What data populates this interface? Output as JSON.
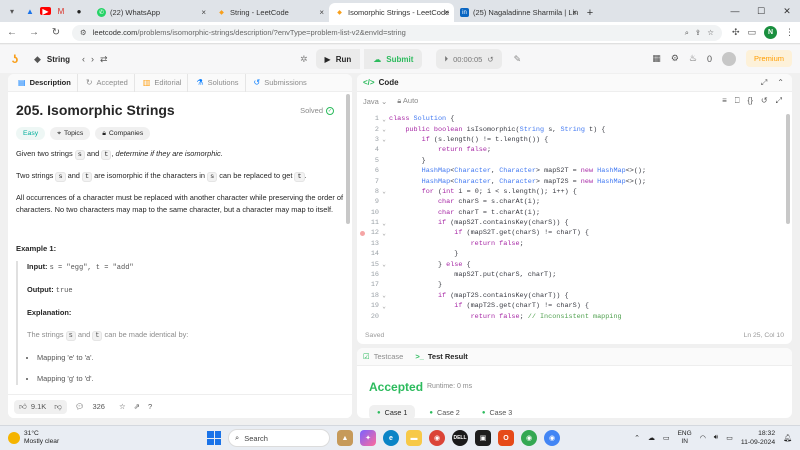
{
  "browser": {
    "tabs": [
      {
        "label": "(22) WhatsApp",
        "active": false
      },
      {
        "label": "String - LeetCode",
        "active": false
      },
      {
        "label": "Isomorphic Strings - LeetCode",
        "active": true
      },
      {
        "label": "(25) Nagaladinne Sharmila | Lin",
        "active": false
      }
    ],
    "new_tab": "+",
    "url_host": "leetcode.com",
    "url_path": "/problems/isomorphic-strings/description/?envType=problem-list-v2&envId=string",
    "profile_initial": "N"
  },
  "header": {
    "problem_list": "String",
    "run_label": "Run",
    "submit_label": "Submit",
    "timer": "00:00:05",
    "notifications": "0",
    "premium": "Premium"
  },
  "left": {
    "tabs": [
      "Description",
      "Accepted",
      "Editorial",
      "Solutions",
      "Submissions"
    ],
    "title": "205. Isomorphic Strings",
    "solved": "Solved",
    "chips": [
      "Easy",
      "Topics",
      "Companies"
    ],
    "para1_a": "Given two strings ",
    "para1_s": "s",
    "para1_b": " and ",
    "para1_t": "t",
    "para1_c": ", ",
    "para1_d": "determine if they are isomorphic",
    "para1_e": ".",
    "para2_a": "Two strings ",
    "para2_s": "s",
    "para2_b": " and ",
    "para2_t": "t",
    "para2_c": " are isomorphic if the characters in ",
    "para2_s2": "s",
    "para2_d": " can be replaced to get ",
    "para2_t2": "t",
    "para2_e": ".",
    "para3": "All occurrences of a character must be replaced with another character while preserving the order of characters. No two characters may map to the same character, but a character may map to itself.",
    "example_title": "Example 1:",
    "input_label": "Input:",
    "input_value": "s = \"egg\", t = \"add\"",
    "output_label": "Output:",
    "output_value": "true",
    "explanation_label": "Explanation:",
    "explanation_a": "The strings ",
    "explanation_s": "s",
    "explanation_b": " and ",
    "explanation_t": "t",
    "explanation_c": " can be made identical by:",
    "bullets": [
      "Mapping 'e' to 'a'.",
      "Mapping 'g' to 'd'."
    ],
    "likes": "9.1K",
    "comments": "326"
  },
  "code": {
    "title": "Code",
    "language": "Java",
    "mode": "Auto",
    "saved": "Saved",
    "cursor": "Ln 25, Col 10",
    "lines": [
      "class Solution {",
      "    public boolean isIsomorphic(String s, String t) {",
      "        if (s.length() != t.length()) {",
      "            return false;",
      "        }",
      "        HashMap<Character, Character> mapS2T = new HashMap<>();",
      "        HashMap<Character, Character> mapT2S = new HashMap<>();",
      "        for (int i = 0; i < s.length(); i++) {",
      "            char charS = s.charAt(i);",
      "            char charT = t.charAt(i);",
      "            if (mapS2T.containsKey(charS)) {",
      "                if (mapS2T.get(charS) != charT) {",
      "                    return false;",
      "                }",
      "            } else {",
      "                mapS2T.put(charS, charT);",
      "            }",
      "            if (mapT2S.containsKey(charT)) {",
      "                if (mapT2S.get(charT) != charS) {",
      "                    return false; // Inconsistent mapping"
    ],
    "fold_lines": [
      1,
      2,
      3,
      8,
      11,
      12,
      15,
      18,
      19
    ],
    "breakpoint_line": 12
  },
  "test": {
    "tab_testcase": "Testcase",
    "tab_result": "Test Result",
    "status": "Accepted",
    "runtime": "Runtime: 0 ms",
    "cases": [
      "Case 1",
      "Case 2",
      "Case 3"
    ]
  },
  "taskbar": {
    "temp": "31°C",
    "weather": "Mostly clear",
    "search": "Search",
    "lang_top": "ENG",
    "lang_bottom": "IN",
    "time": "18:32",
    "date": "11-09-2024"
  },
  "colors": {
    "accent_green": "#2cbb5d",
    "leetcode_orange": "#f89f1b",
    "easy": "#00af9b"
  }
}
